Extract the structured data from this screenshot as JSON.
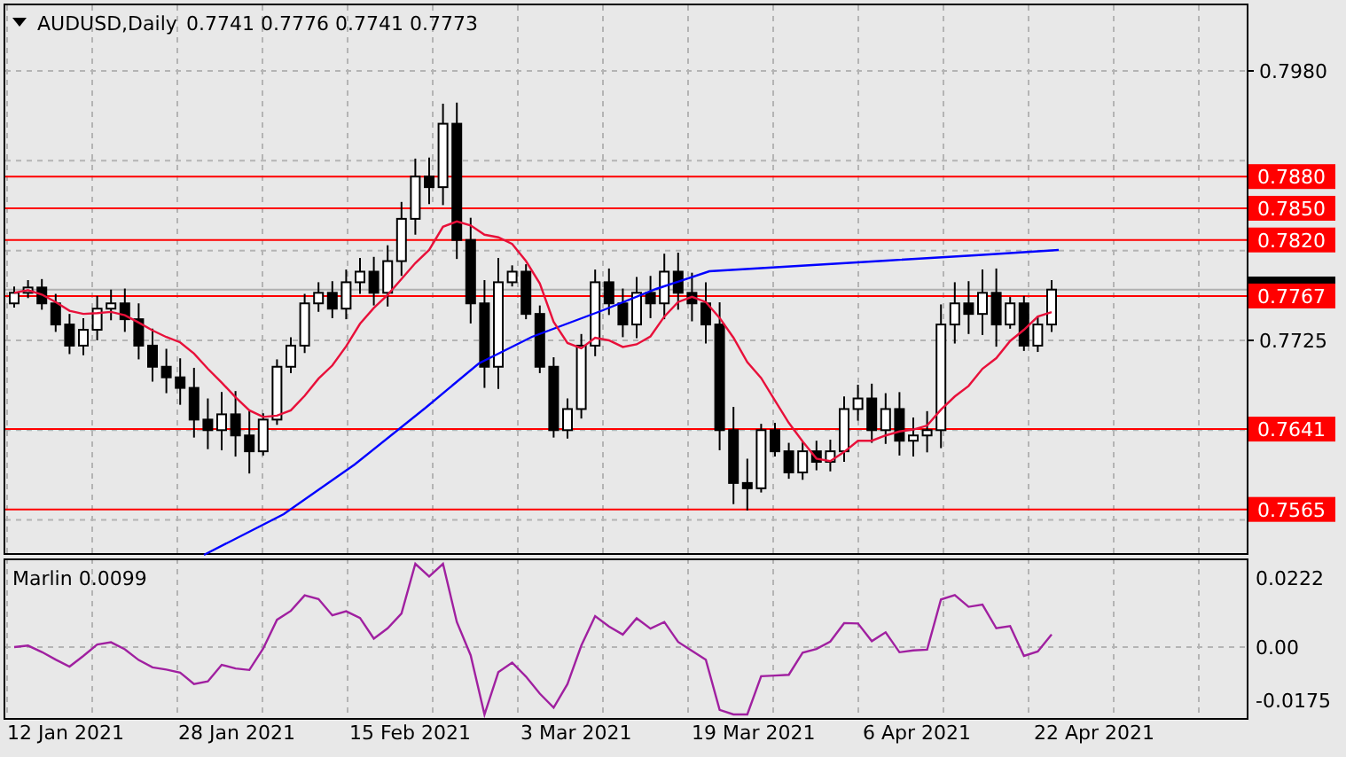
{
  "symbol": {
    "title": "AUDUSD,Daily",
    "ohlc": [
      "0.7741",
      "0.7776",
      "0.7741",
      "0.7773"
    ]
  },
  "price_axis": {
    "ticks": [
      "0.7980",
      "0.7725"
    ]
  },
  "levels": [
    {
      "label": "0.7880"
    },
    {
      "label": "0.7850"
    },
    {
      "label": "0.7820"
    },
    {
      "label": "0.7767"
    },
    {
      "label": "0.7641"
    },
    {
      "label": "0.7565"
    }
  ],
  "indicator": {
    "title": "Marlin 0.0099",
    "ticks": [
      "0.0222",
      "0.00",
      "-0.0175"
    ]
  },
  "time_axis": {
    "labels": [
      "12 Jan 2021",
      "28 Jan 2021",
      "15 Feb 2021",
      "3 Mar 2021",
      "19 Mar 2021",
      "6 Apr 2021",
      "22 Apr 2021"
    ]
  }
}
